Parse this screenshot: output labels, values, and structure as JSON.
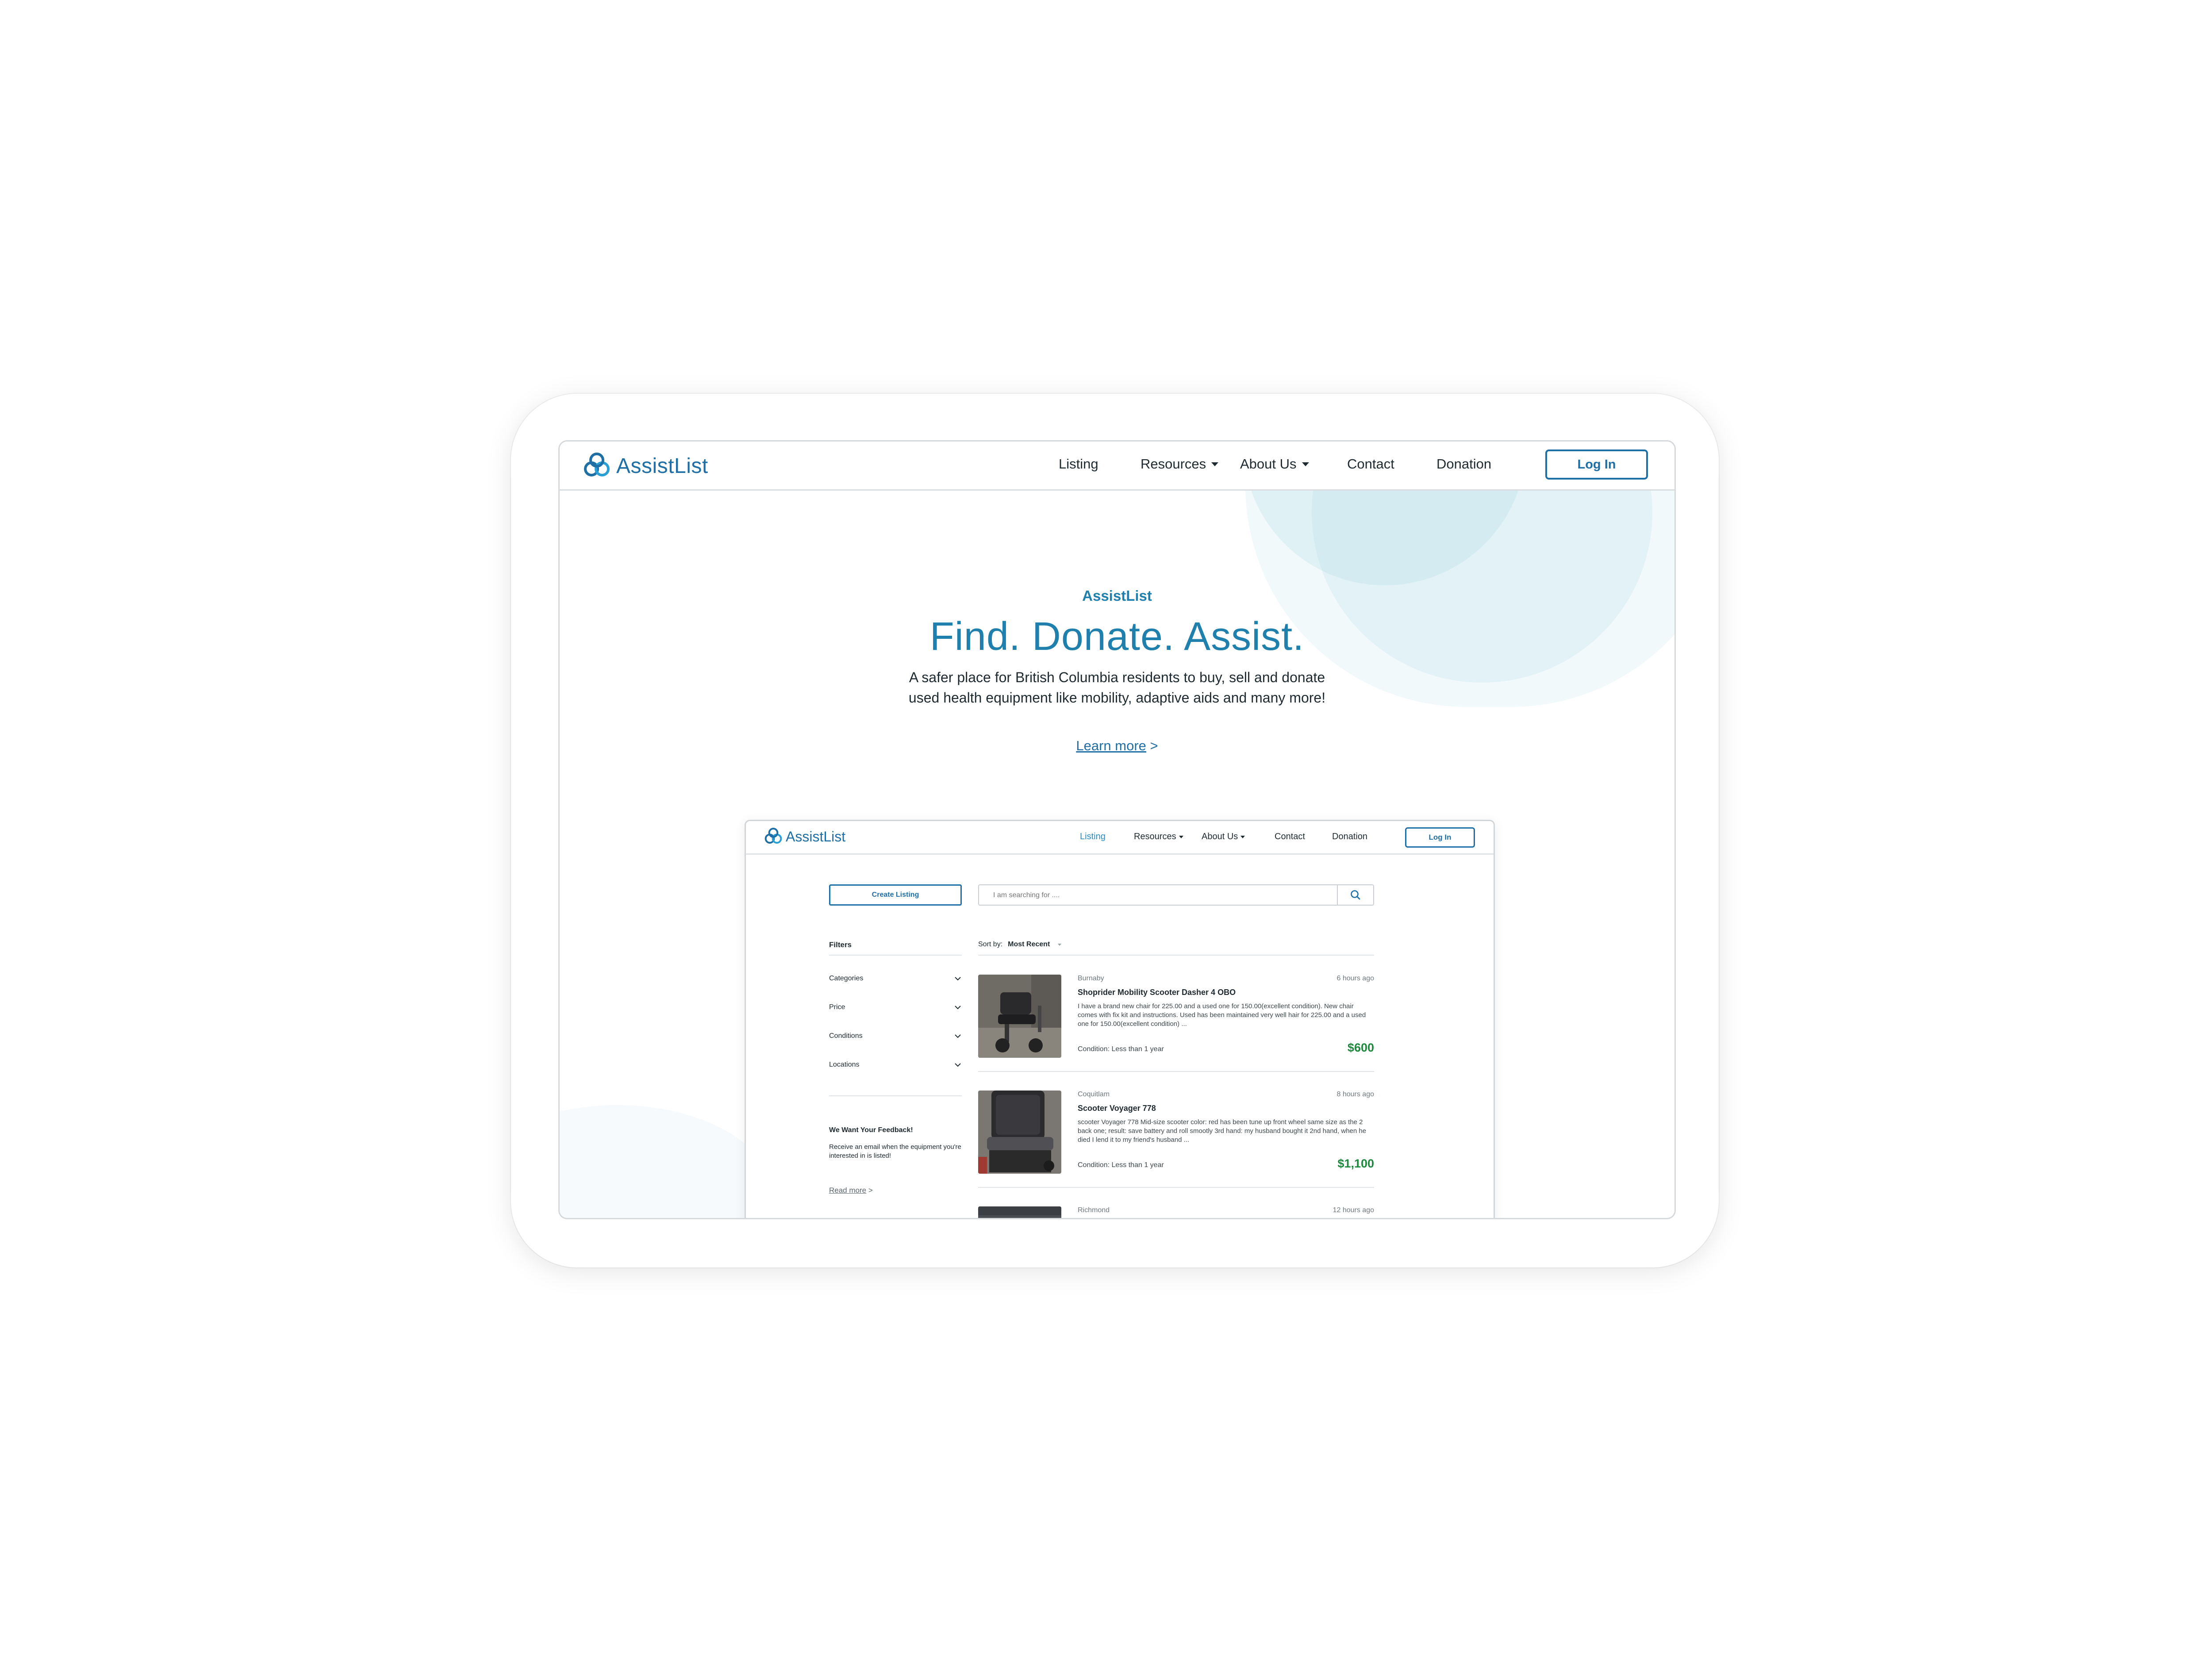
{
  "site": {
    "name": "AssistList",
    "accent": "#1f6fa7",
    "price_color": "#1d8a3e"
  },
  "nav": {
    "items": [
      {
        "label": "Listing",
        "dropdown": false
      },
      {
        "label": "Resources",
        "dropdown": true
      },
      {
        "label": "About Us",
        "dropdown": true
      },
      {
        "label": "Contact",
        "dropdown": false
      },
      {
        "label": "Donation",
        "dropdown": false
      }
    ],
    "login_label": "Log In"
  },
  "hero": {
    "eyebrow": "AssistList",
    "title": "Find. Donate. Assist.",
    "description": "A safer place for British Columbia residents to buy, sell and donate used health equipment like mobility, adaptive aids and many more!",
    "link_text": "Learn more",
    "link_arrow": ">"
  },
  "preview": {
    "nav": {
      "items": [
        "Listing",
        "Resources",
        "About Us",
        "Contact",
        "Donation"
      ],
      "active": "Listing",
      "login_label": "Log In"
    },
    "create_listing_label": "Create Listing",
    "search_placeholder": "I am searching for ....",
    "filters": {
      "title": "Filters",
      "items": [
        "Categories",
        "Price",
        "Conditions",
        "Locations"
      ]
    },
    "feedback": {
      "title": "We Want Your Feedback!",
      "description": "Receive an email when the equipment you're interested in is listed!",
      "link_text": "Read more",
      "link_arrow": ">"
    },
    "sort": {
      "label": "Sort by:",
      "value": "Most Recent"
    },
    "listings": [
      {
        "location": "Burnaby",
        "time": "6 hours ago",
        "title": "Shoprider Mobility Scooter Dasher 4 OBO",
        "description": "I have a brand new chair for 225.00 and a used one for 150.00(excellent condition). New chair comes with fix kit and instructions. Used has been maintained very well hair for 225.00 and a used one for 150.00(excellent condition) ...",
        "condition": "Condition: Less than 1 year",
        "price": "$600"
      },
      {
        "location": "Coquitlam",
        "time": "8 hours ago",
        "title": "Scooter Voyager 778",
        "description": "scooter Voyager 778 Mid-size scooter color: red has been tune up front wheel same size as the 2 back one; result: save battery and roll smootly 3rd hand: my husband bought it 2nd hand, when he died I lend it to my friend's husband ...",
        "condition": "Condition: Less than 1 year",
        "price": "$1,100"
      },
      {
        "location": "Richmond",
        "time": "12 hours ago",
        "title": "",
        "description": "",
        "condition": "",
        "price": ""
      }
    ]
  }
}
